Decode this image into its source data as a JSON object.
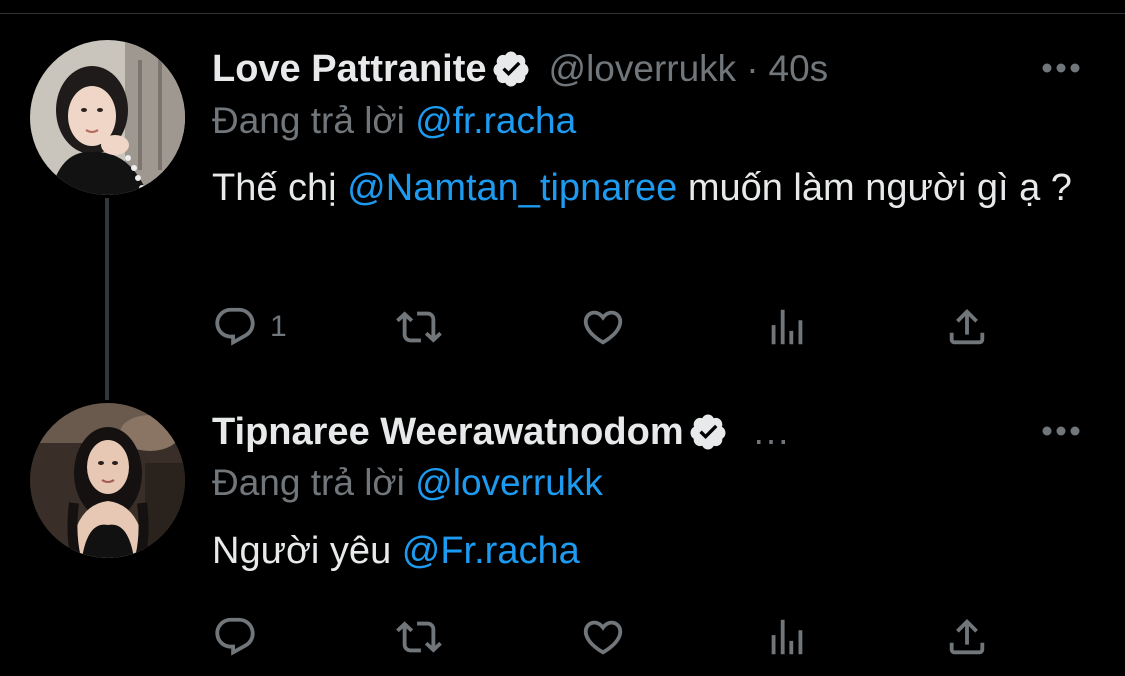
{
  "tweets": [
    {
      "name": "Love Pattranite",
      "handle": "@loverrukk",
      "separator": "·",
      "time": "40s",
      "reply_prefix": "Đang trả lời",
      "reply_to": "@fr.racha",
      "body_before": "Thế chị ",
      "body_mention": "@Namtan_tipnaree",
      "body_after": " muốn làm người gì ạ ?",
      "reply_count": "1"
    },
    {
      "name": "Tipnaree Weerawatnodom",
      "ellipsis": "...",
      "reply_prefix": "Đang trả lời",
      "reply_to": "@loverrukk",
      "body_before": "Người yêu ",
      "body_mention": "@Fr.racha"
    }
  ],
  "colors": {
    "background": "#000000",
    "primary_text": "#e7e9ea",
    "secondary_text": "#71767b",
    "link": "#1d9bf0",
    "thread_line": "#333639"
  },
  "icons": {
    "verified": "verified-badge-icon",
    "more": "more-options-icon",
    "reply": "reply-icon",
    "retweet": "retweet-icon",
    "like": "like-icon",
    "analytics": "analytics-icon",
    "share": "share-icon"
  }
}
